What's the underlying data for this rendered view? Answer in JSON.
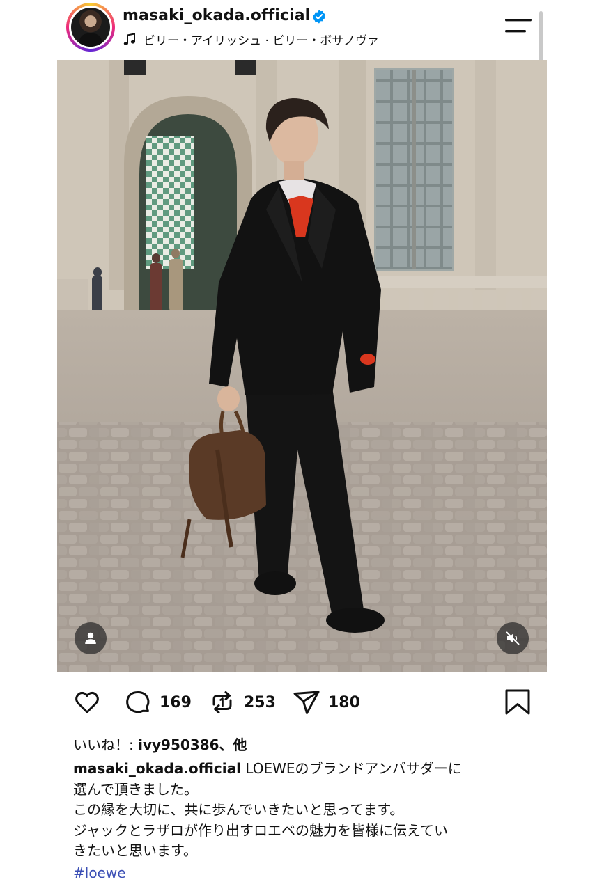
{
  "header": {
    "username": "masaki_okada.official",
    "verified": true,
    "music": "ビリー・アイリッシュ · ビリー・ボサノヴァ",
    "menu_icon": "hamburger-menu-icon"
  },
  "post": {
    "photo_description_icon": "photo",
    "tag_icon": "person-tag-icon",
    "mute_icon": "speaker-muted-icon"
  },
  "actions": {
    "likes_icon": "heart-icon",
    "comments_count": "169",
    "reposts_count": "253",
    "shares_count": "180"
  },
  "likes_line": {
    "prefix": "いいね！: ",
    "user": "ivy950386",
    "suffix": "、他"
  },
  "caption": {
    "user": "masaki_okada.official",
    "line1": " LOEWEのブランドアンバサダーに",
    "line2": "選んで頂きました。",
    "line3": "この縁を大切に、共に歩んでいきたいと思ってます。",
    "line4": "ジャックとラザロが作り出すロエベの魅力を皆様に伝えてい",
    "line5": "きたいと思います。",
    "hashtag": "#loewe"
  },
  "colors": {
    "hashtag": "#3b4fb5",
    "verified": "#0095f6"
  }
}
